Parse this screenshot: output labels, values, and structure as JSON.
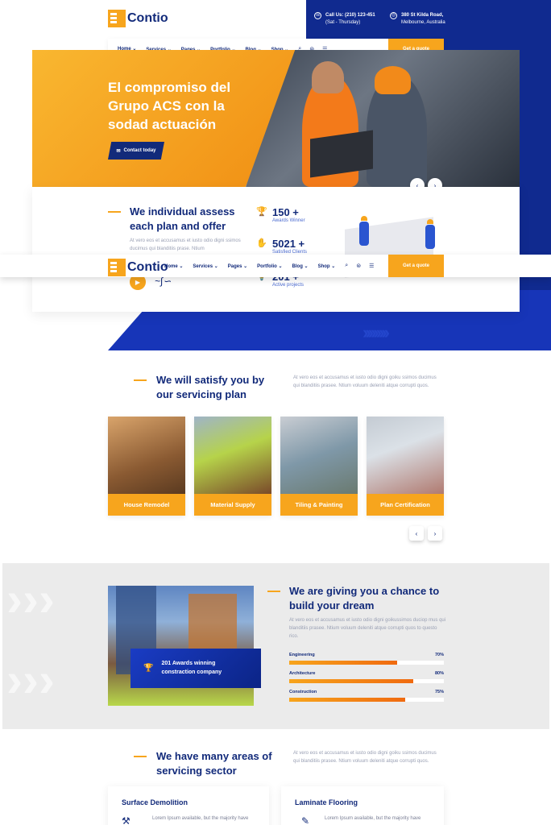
{
  "brand": {
    "name": "Contio"
  },
  "header": {
    "call_title": "Call Us: (210) 123-451",
    "call_sub": "(Sat - Thursday)",
    "addr_title": "380 St Kilda Road,",
    "addr_sub": "Melbourne, Australia"
  },
  "nav": {
    "items": [
      "Home",
      "Services",
      "Pages",
      "Portfolio",
      "Blog",
      "Shop"
    ],
    "quote": "Get a quote"
  },
  "hero": {
    "title": "El compromiso del Grupo ACS con la sodad actuación",
    "button": "Contact today"
  },
  "assess": {
    "title": "We individual assess each plan and offer",
    "text": "At vero eos et accusamus et iusto odio digni ssimos ducimus qui blanditiis prase. Ntium",
    "stats": [
      {
        "num": "150 +",
        "label": "Awards Winner"
      },
      {
        "num": "5021 +",
        "label": "Satisfied Clients"
      },
      {
        "num": "201 +",
        "label": "Active projects"
      }
    ]
  },
  "services": {
    "title": "We will satisfy you by our servicing plan",
    "text": "At vero eos et accusamus et iusto odio digni goiku ssimos ducimus qui blanditiis prasee. Ntium voluum deleniti atque corrupti quos.",
    "cards": [
      "House Remodel",
      "Material Supply",
      "Tiling & Painting",
      "Plan Certification"
    ]
  },
  "dream": {
    "title": "We are giving you a chance to build your dream",
    "text": "At vero eos et accusamus et iusto odio digni goikussimos duciop mus qui blanditiis prasee. Ntium voluum deleniti atque corrupti quos to questo rico.",
    "award": "201 Awards winning constraction company",
    "skills": [
      {
        "label": "Engineering",
        "pct": "70%",
        "value": 0.7
      },
      {
        "label": "Architecture",
        "pct": "80%",
        "value": 0.8
      },
      {
        "label": "Construction",
        "pct": "75%",
        "value": 0.75
      }
    ]
  },
  "sectors": {
    "title": "We have many areas of servicing sector",
    "text": "At vero eos et accusamus et iusto odio digni goiku ssimos ducimus qui blanditiis prasee. Ntium voluum deleniti atque corrupti quos.",
    "cards": [
      {
        "title": "Surface Demolition",
        "text": "Lorem Ipsum available, but the majority have"
      },
      {
        "title": "Laminate Flooring",
        "text": "Lorem Ipsum available, but the majority have"
      }
    ]
  },
  "colors": {
    "accent": "#f7a51d",
    "navy": "#122a7a",
    "blue": "#102a8f"
  }
}
